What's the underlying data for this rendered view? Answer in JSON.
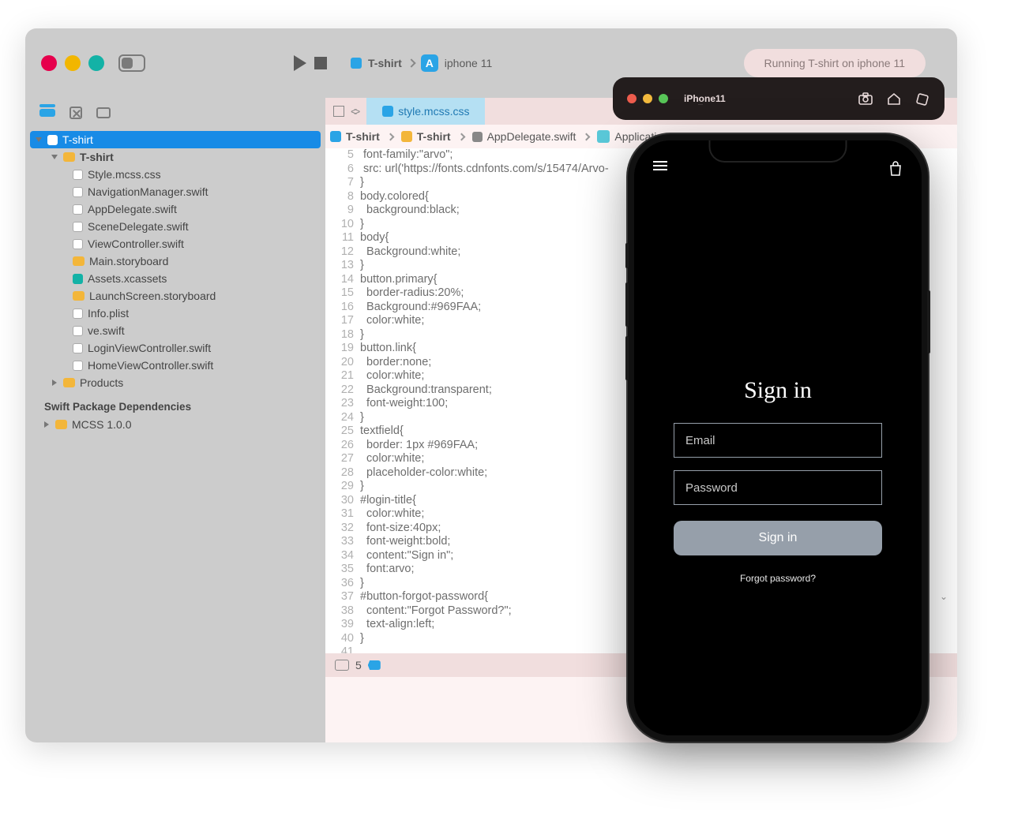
{
  "titlebar": {
    "scheme": "T-shirt",
    "device": "iphone 11",
    "status": "Running T-shirt on iphone 11"
  },
  "sidebar": {
    "root": "T-shirt",
    "group": "T-shirt",
    "files": [
      "Style.mcss.css",
      "NavigationManager.swift",
      "AppDelegate.swift",
      "SceneDelegate.swift",
      "ViewController.swift",
      "Main.storyboard",
      "Assets.xcassets",
      "LaunchScreen.storyboard",
      "Info.plist",
      "ve.swift",
      "LoginViewController.swift",
      "HomeViewController.swift"
    ],
    "products": "Products",
    "deps_header": "Swift Package Dependencies",
    "dep": "MCSS 1.0.0"
  },
  "tab": {
    "title": "style.mcss.css"
  },
  "crumbs": {
    "a": "T-shirt",
    "b": "T-shirt",
    "c": "AppDelegate.swift",
    "d": "Application(_:didFinishLaunchingWithOptions:)"
  },
  "code": {
    "lines": [
      " font-family:\"arvo\";",
      " src: url('https://fonts.cdnfonts.com/s/15474/Arvo-",
      "}",
      "body.colored{",
      "  background:black;",
      "}",
      "body{",
      "  Background:white;",
      "}",
      "button.primary{",
      "  border-radius:20%;",
      "  Background:#969FAA;",
      "  color:white;",
      "}",
      "button.link{",
      "  border:none;",
      "  color:white;",
      "  Background:transparent;",
      "  font-weight:100;",
      "}",
      "textfield{",
      "  border: 1px #969FAA;",
      "  color:white;",
      "  placeholder-color:white;",
      "}",
      "#login-title{",
      "  color:white;",
      "  font-size:40px;",
      "  font-weight:bold;",
      "  content:\"Sign in\";",
      "  font:arvo;",
      "}",
      "#button-forgot-password{",
      "  content:\"Forgot Password?\";",
      "  text-align:left;",
      "}",
      "",
      "",
      "",
      ""
    ],
    "start": 5
  },
  "bottombar": {
    "count": "5"
  },
  "sim": {
    "title": "iPhone11"
  },
  "phone": {
    "heading": "Sign in",
    "email_ph": "Email",
    "password_ph": "Password",
    "signin_btn": "Sign in",
    "forgot": "Forgot password?"
  }
}
